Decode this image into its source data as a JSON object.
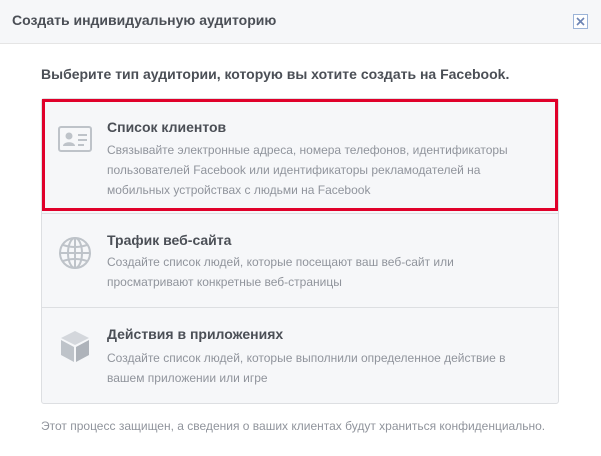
{
  "dialog": {
    "title": "Создать индивидуальную аудиторию",
    "close_icon": "close-icon"
  },
  "prompt": "Выберите тип аудитории, которую вы хотите создать на Facebook.",
  "options": [
    {
      "icon": "contact-card-icon",
      "title": "Список клиентов",
      "description": "Связывайте электронные адреса, номера телефонов, идентификаторы пользователей Facebook или идентификаторы рекламодателей на мобильных устройствах с людьми на Facebook",
      "highlighted": true
    },
    {
      "icon": "globe-icon",
      "title": "Трафик веб-сайта",
      "description": "Создайте список людей, которые посещают ваш веб-сайт или просматривают конкретные веб-страницы"
    },
    {
      "icon": "cube-icon",
      "title": "Действия в приложениях",
      "description": "Создайте список людей, которые выполнили определенное действие в вашем приложении или игре"
    }
  ],
  "footer": "Этот процесс защищен, а сведения о ваших клиентах будут храниться конфиденциально.",
  "colors": {
    "highlight": "#e0002a",
    "icon": "#bec3c9",
    "text_primary": "#4b4f56",
    "text_secondary": "#90949c"
  }
}
